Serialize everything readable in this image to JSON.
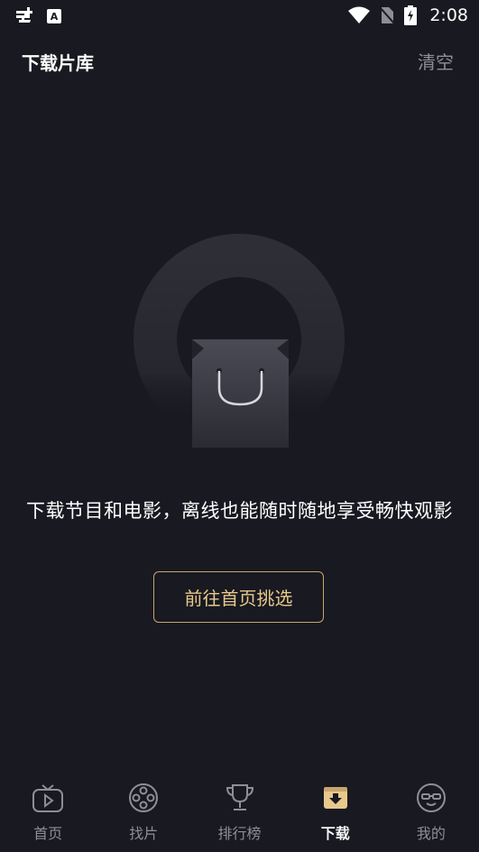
{
  "status_bar": {
    "time": "2:08",
    "a_badge": "A"
  },
  "header": {
    "title": "下载片库",
    "clear_label": "清空"
  },
  "empty_state": {
    "message": "下载节目和电影，离线也能随时随地享受畅快观影",
    "button_label": "前往首页挑选"
  },
  "colors": {
    "background": "#181921",
    "accent_gold": "#c9a56b",
    "inactive": "#8e8f96"
  },
  "bottom_nav": {
    "items": [
      {
        "label": "首页",
        "icon": "tv-play-icon"
      },
      {
        "label": "找片",
        "icon": "film-reel-icon"
      },
      {
        "label": "排行榜",
        "icon": "trophy-icon"
      },
      {
        "label": "下载",
        "icon": "download-icon",
        "active": true
      },
      {
        "label": "我的",
        "icon": "face-icon"
      }
    ]
  }
}
